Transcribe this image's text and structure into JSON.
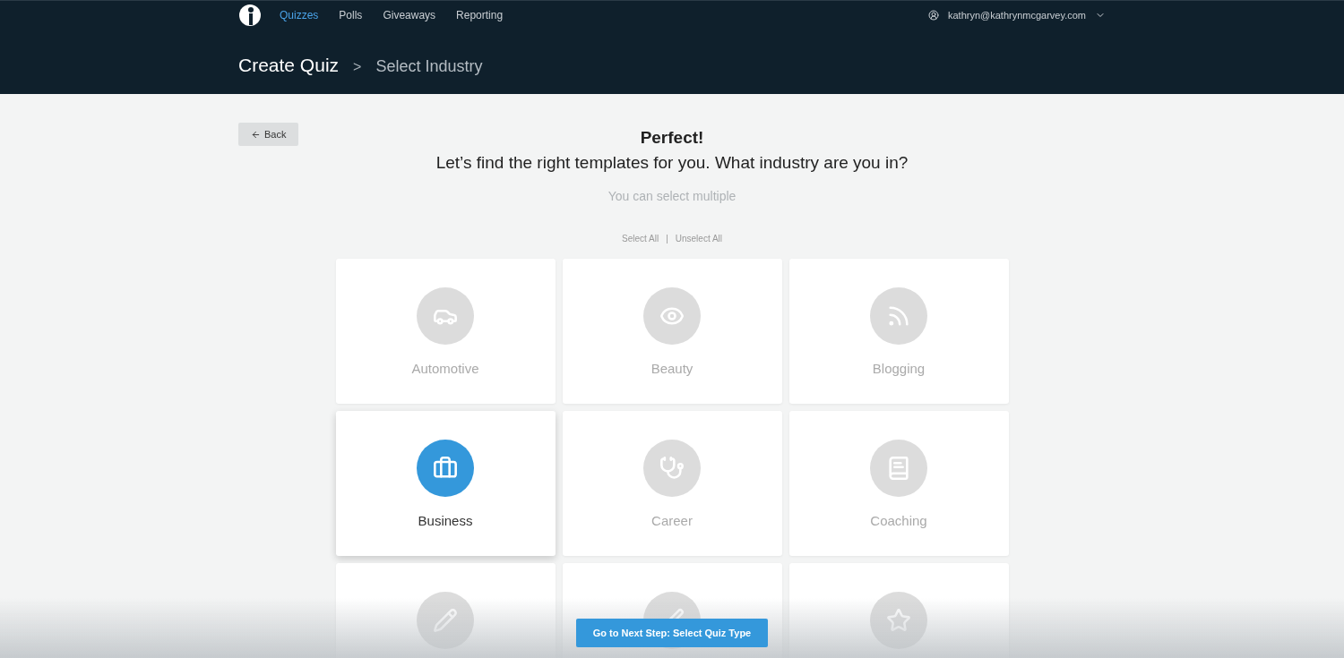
{
  "nav": {
    "items": [
      {
        "label": "Quizzes",
        "selected": true
      },
      {
        "label": "Polls",
        "selected": false
      },
      {
        "label": "Giveaways",
        "selected": false
      },
      {
        "label": "Reporting",
        "selected": false
      }
    ],
    "user": "kathryn@kathrynmcgarvey.com"
  },
  "breadcrumb": {
    "title": "Create Quiz",
    "separator": ">",
    "current": "Select Industry"
  },
  "back_button": "Back",
  "heading": "Perfect!",
  "question": "Let’s find the right templates for you. What industry are you in?",
  "hint": "You can select multiple",
  "select_all": "Select All",
  "divider": "|",
  "unselect_all": "Unselect All",
  "industries": [
    {
      "kind": "car",
      "label": "Automotive",
      "selected": false
    },
    {
      "kind": "eye",
      "label": "Beauty",
      "selected": false
    },
    {
      "kind": "rss",
      "label": "Blogging",
      "selected": false
    },
    {
      "kind": "briefcase",
      "label": "Business",
      "selected": true
    },
    {
      "kind": "doctor",
      "label": "Career",
      "selected": false
    },
    {
      "kind": "book",
      "label": "Coaching",
      "selected": false
    },
    {
      "kind": "pencil",
      "selected": false
    },
    {
      "kind": "brush",
      "selected": false
    },
    {
      "kind": "star",
      "selected": false
    }
  ],
  "next_button": "Go to Next Step: Select Quiz Type"
}
